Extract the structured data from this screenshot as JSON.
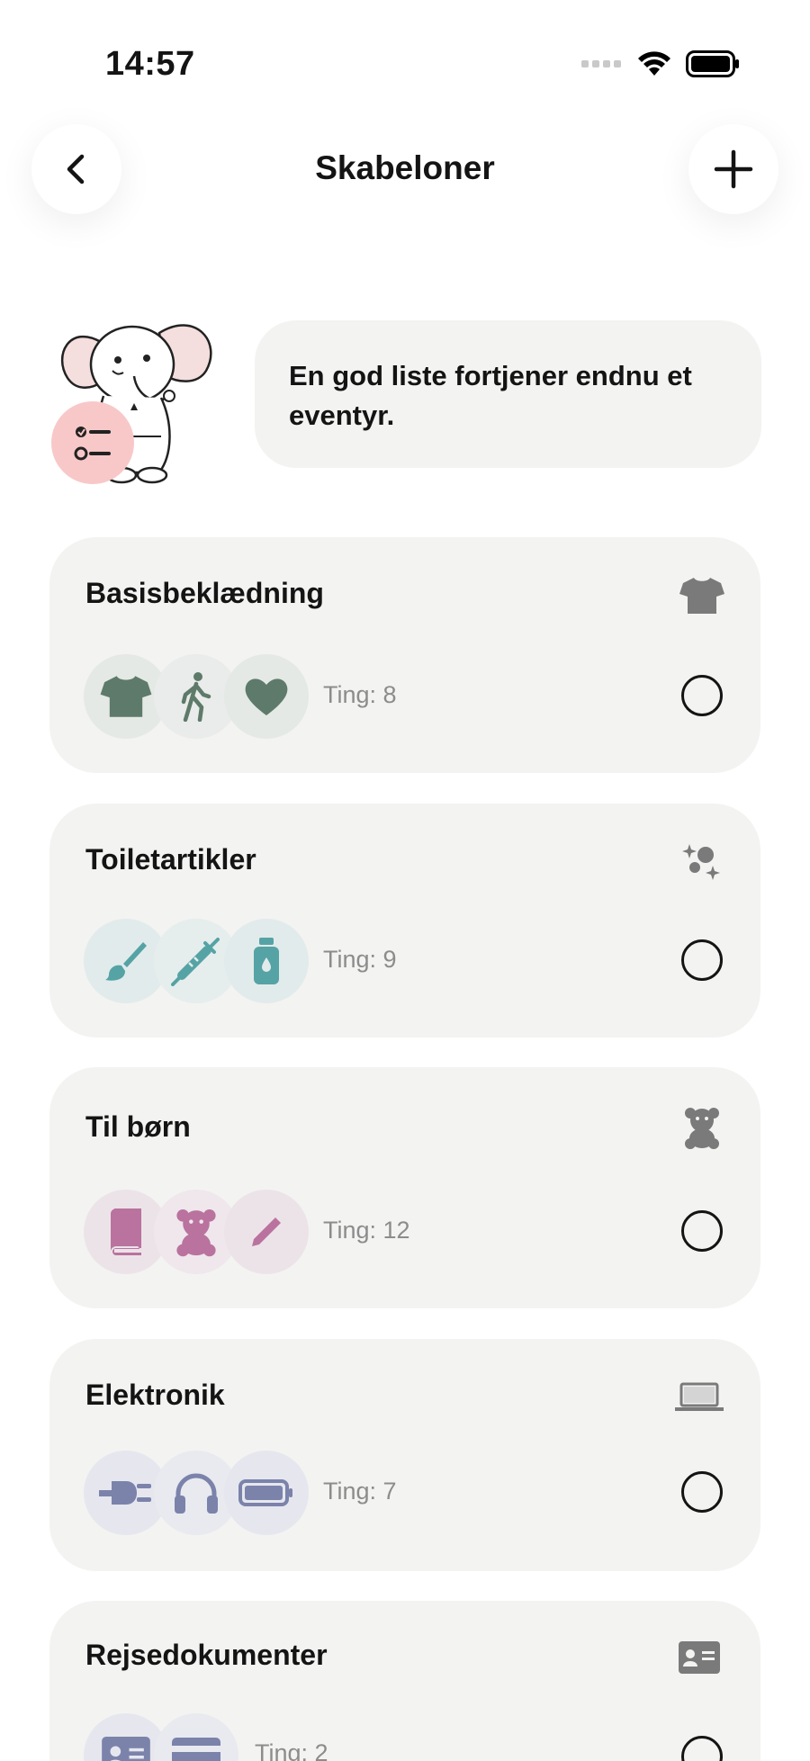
{
  "status": {
    "time": "14:57"
  },
  "nav": {
    "title": "Skabeloner"
  },
  "intro": {
    "message": "En god liste fortjener endnu et eventyr."
  },
  "templates": [
    {
      "title": "Basisbeklædning",
      "count": "Ting: 8",
      "icon": "tshirt-icon",
      "accent": "#5e7a6a",
      "thumb_icons": [
        "tshirt-icon",
        "walking-person-icon",
        "heart-icon"
      ]
    },
    {
      "title": "Toiletartikler",
      "count": "Ting: 9",
      "icon": "sparkle-bubbles-icon",
      "accent": "#56a3a5",
      "thumb_icons": [
        "brush-icon",
        "syringe-icon",
        "bottle-icon"
      ]
    },
    {
      "title": "Til børn",
      "count": "Ting: 12",
      "icon": "teddy-bear-icon",
      "accent": "#b9739e",
      "thumb_icons": [
        "book-icon",
        "teddy-bear-icon",
        "pencil-icon"
      ]
    },
    {
      "title": "Elektronik",
      "count": "Ting: 7",
      "icon": "laptop-icon",
      "accent": "#7b83ab",
      "thumb_icons": [
        "plug-icon",
        "headphones-icon",
        "battery-icon"
      ]
    },
    {
      "title": "Rejsedokumenter",
      "count": "Ting: 2",
      "icon": "id-card-icon",
      "accent": "#7b83ab",
      "thumb_icons": [
        "id-card-icon",
        "credit-card-icon"
      ]
    }
  ]
}
